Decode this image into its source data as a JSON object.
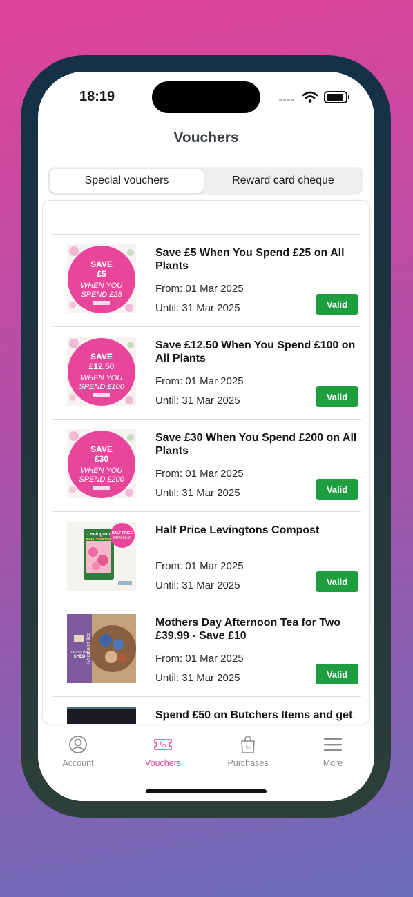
{
  "status_bar": {
    "time": "18:19"
  },
  "header": {
    "title": "Vouchers"
  },
  "tabs": [
    {
      "label": "Special vouchers",
      "active": true
    },
    {
      "label": "Reward card cheque",
      "active": false
    }
  ],
  "vouchers": [
    {
      "title": "Save £5 When You Spend £25 on All Plants",
      "from": "From: 01 Mar 2025",
      "until": "Until: 31 Mar 2025",
      "status": "Valid",
      "image": {
        "kind": "badge",
        "line1": "SAVE",
        "line2": "£5",
        "line3": "WHEN YOU",
        "line4": "SPEND £25"
      }
    },
    {
      "title": "Save £12.50 When You Spend £100 on All Plants",
      "from": "From: 01 Mar 2025",
      "until": "Until: 31 Mar 2025",
      "status": "Valid",
      "image": {
        "kind": "badge",
        "line1": "SAVE",
        "line2": "£12.50",
        "line3": "WHEN YOU",
        "line4": "SPEND £100"
      }
    },
    {
      "title": "Save £30 When You Spend £200 on All Plants",
      "from": "From: 01 Mar 2025",
      "until": "Until: 31 Mar 2025",
      "status": "Valid",
      "image": {
        "kind": "badge",
        "line1": "SAVE",
        "line2": "£30",
        "line3": "WHEN YOU",
        "line4": "SPEND £200"
      }
    },
    {
      "title": "Half Price Levingtons Compost",
      "from": "From: 01 Mar 2025",
      "until": "Until: 31 Mar 2025",
      "status": "Valid",
      "image": {
        "kind": "compost",
        "line1": "HALF PRICE",
        "line2": "NOW £5.50",
        "brand": "Levington",
        "label": "MULTI PURPOSE"
      }
    },
    {
      "title": "Mothers Day Afternoon Tea for Two £39.99 - Save £10",
      "from": "From: 01 Mar 2025",
      "until": "Until: 31 Mar 2025",
      "status": "Valid",
      "image": {
        "kind": "tea",
        "line1": "THE POTTING",
        "line2": "SHED",
        "side": "Afternoon Tea"
      }
    },
    {
      "title": "Spend £50 on Butchers Items and get",
      "from": "",
      "until": "",
      "status": "",
      "image": {
        "kind": "dark"
      }
    }
  ],
  "tabbar": {
    "items": [
      {
        "label": "Account",
        "icon": "account-icon"
      },
      {
        "label": "Vouchers",
        "icon": "voucher-icon",
        "active": true
      },
      {
        "label": "Purchases",
        "icon": "shopping-bag-icon"
      },
      {
        "label": "More",
        "icon": "menu-icon"
      }
    ]
  },
  "colors": {
    "accent": "#e3469c",
    "valid": "#1f9e3f",
    "inactive": "#8d8d8d"
  }
}
